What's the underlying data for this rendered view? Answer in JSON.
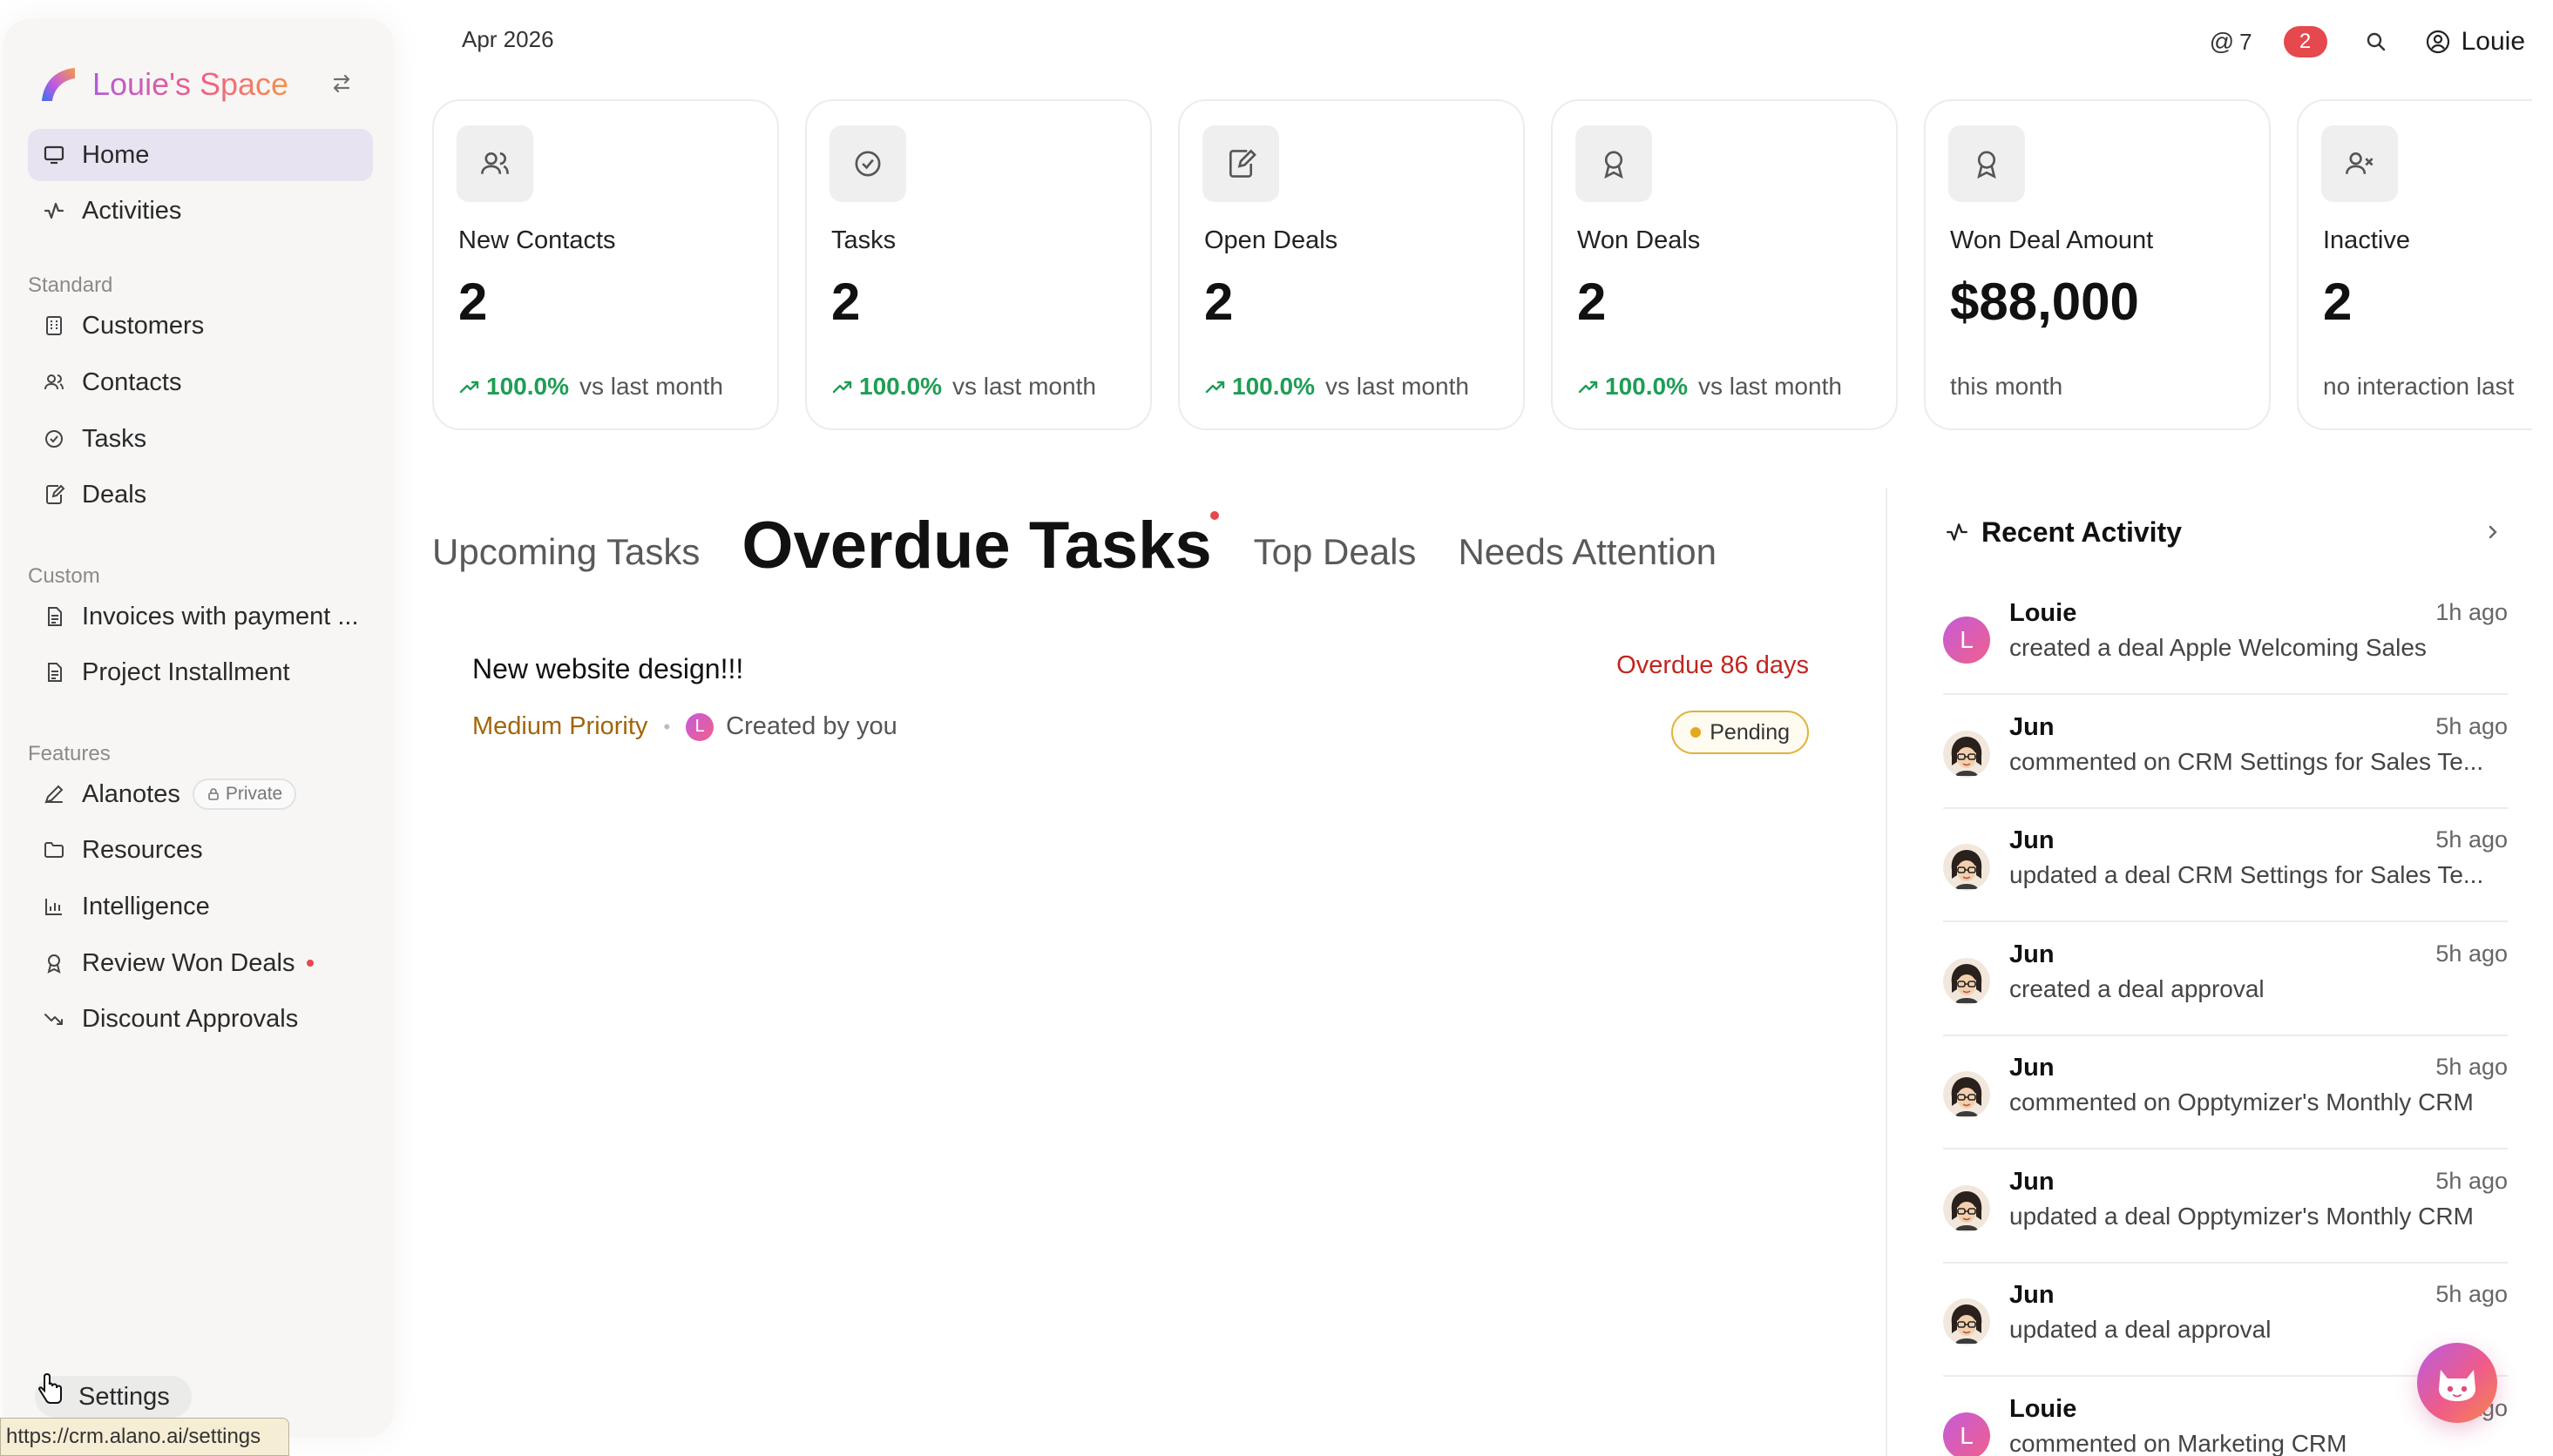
{
  "sidebar": {
    "brand": "Louie's Space",
    "home": "Home",
    "activities": "Activities",
    "standard_label": "Standard",
    "standard": [
      "Customers",
      "Contacts",
      "Tasks",
      "Deals"
    ],
    "custom_label": "Custom",
    "custom": [
      "Invoices with payment ...",
      "Project Installment"
    ],
    "features_label": "Features",
    "alanotes": "Alanotes",
    "private_badge": "Private",
    "features": [
      "Resources",
      "Intelligence",
      "Review Won Deals",
      "Discount Approvals"
    ],
    "settings": "Settings"
  },
  "status_url": "https://crm.alano.ai/settings",
  "topbar": {
    "date": "Apr 2026",
    "mentions_count": "7",
    "notifications_count": "2",
    "user": "Louie"
  },
  "cards": [
    {
      "title": "New Contacts",
      "value": "2",
      "pct": "100.0%",
      "note": "vs last month",
      "icon": "users-icon"
    },
    {
      "title": "Tasks",
      "value": "2",
      "pct": "100.0%",
      "note": "vs last month",
      "icon": "check-circle-icon"
    },
    {
      "title": "Open Deals",
      "value": "2",
      "pct": "100.0%",
      "note": "vs last month",
      "icon": "edit-doc-icon"
    },
    {
      "title": "Won Deals",
      "value": "2",
      "pct": "100.0%",
      "note": "vs last month",
      "icon": "award-icon"
    },
    {
      "title": "Won Deal Amount",
      "value": "$88,000",
      "note": "this month",
      "icon": "award-icon"
    },
    {
      "title": "Inactive",
      "value": "2",
      "note": "no interaction last",
      "icon": "user-x-icon"
    }
  ],
  "tabs": [
    "Upcoming Tasks",
    "Overdue Tasks",
    "Top Deals",
    "Needs Attention"
  ],
  "task": {
    "title": "New website design!!!",
    "overdue": "Overdue 86 days",
    "priority": "Medium Priority",
    "avatar_letter": "L",
    "created": "Created by you",
    "status": "Pending"
  },
  "recent_activity": {
    "title": "Recent Activity",
    "items": [
      {
        "name": "Louie",
        "time": "1h ago",
        "text": "created a deal Apple Welcoming Sales",
        "avatar": "letter"
      },
      {
        "name": "Jun",
        "time": "5h ago",
        "text": "commented on CRM Settings for Sales Te...",
        "avatar": "photo"
      },
      {
        "name": "Jun",
        "time": "5h ago",
        "text": "updated a deal CRM Settings for Sales Te...",
        "avatar": "photo"
      },
      {
        "name": "Jun",
        "time": "5h ago",
        "text": "created a deal approval",
        "avatar": "photo"
      },
      {
        "name": "Jun",
        "time": "5h ago",
        "text": "commented on Opptymizer's Monthly CRM",
        "avatar": "photo"
      },
      {
        "name": "Jun",
        "time": "5h ago",
        "text": "updated a deal Opptymizer's Monthly CRM",
        "avatar": "photo"
      },
      {
        "name": "Jun",
        "time": "5h ago",
        "text": "updated a deal approval",
        "avatar": "photo"
      },
      {
        "name": "Louie",
        "time": "5h ago",
        "text": "commented on Marketing CRM",
        "avatar": "letter"
      }
    ]
  },
  "colors": {
    "accent_green": "#1f9d55",
    "overdue_red": "#c0261f",
    "priority_amber": "#a0660a",
    "badge_red": "#e5484d",
    "active_nav": "#e7e3f0"
  }
}
